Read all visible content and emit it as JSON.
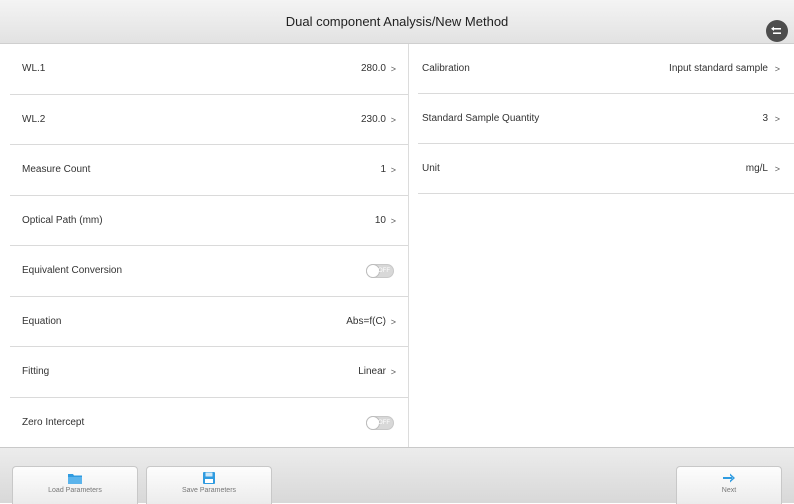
{
  "header": {
    "title": "Dual component Analysis/New Method"
  },
  "left_items": [
    {
      "label": "WL.1",
      "value": "280.0",
      "chevron": ">"
    },
    {
      "label": "WL.2",
      "value": "230.0",
      "chevron": ">"
    },
    {
      "label": "Measure Count",
      "value": "1",
      "chevron": ">"
    },
    {
      "label": "Optical Path (mm)",
      "value": "10",
      "chevron": ">"
    },
    {
      "label": "Equivalent Conversion",
      "toggle": "OFF"
    },
    {
      "label": "Equation",
      "value": "Abs=f(C)",
      "chevron": ">"
    },
    {
      "label": "Fitting",
      "value": "Linear",
      "chevron": ">"
    },
    {
      "label": "Zero Intercept",
      "toggle": "OFF"
    }
  ],
  "right_items": [
    {
      "label": "Calibration",
      "value": "Input standard sample",
      "chevron": ">"
    },
    {
      "label": "Standard Sample Quantity",
      "value": "3",
      "chevron": ">"
    },
    {
      "label": "Unit",
      "value": "mg/L",
      "chevron": ">"
    }
  ],
  "footer": {
    "load_label": "Load Parameters",
    "save_label": "Save Parameters",
    "next_label": "Next"
  },
  "colors": {
    "accent_blue": "#2f9be0",
    "header_bg": "#e8e8e8",
    "back_button": "#4d4d4d"
  },
  "icons": {
    "back": "back-arrow-icon",
    "load": "folder-icon",
    "save": "save-disk-icon",
    "next": "arrow-right-icon"
  }
}
